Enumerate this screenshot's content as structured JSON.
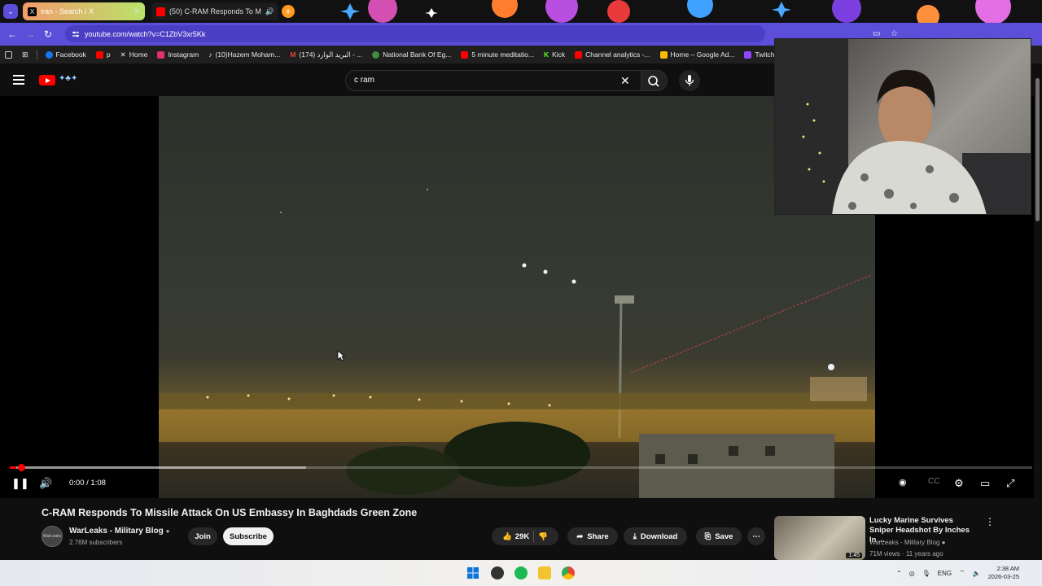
{
  "browser": {
    "tabs": [
      {
        "label": "iran - Search / X",
        "active": false
      },
      {
        "label": "(50) C-RAM Responds To M",
        "active": true
      }
    ],
    "new_tab": "+",
    "url": "youtube.com/watch?v=C1ZbV3xr5Kk",
    "bookmarks": [
      {
        "label": "Facebook",
        "icon": "facebook-icon",
        "color": "#1877f2"
      },
      {
        "label": "p",
        "icon": "youtube-icon",
        "color": "#ff0000"
      },
      {
        "label": "Home",
        "icon": "x-icon",
        "color": "#ffffff"
      },
      {
        "label": "Instagram",
        "icon": "instagram-icon",
        "color": "#e1306c"
      },
      {
        "label": "(10)Hazem Moham...",
        "icon": "tiktok-icon",
        "color": "#ffffff"
      },
      {
        "label": "(174) البريد الوارد - ...",
        "icon": "gmail-icon",
        "color": "#ea4335"
      },
      {
        "label": "National Bank Of Eg...",
        "icon": "bank-icon",
        "color": "#3d8f3d"
      },
      {
        "label": "5 minute meditatio...",
        "icon": "youtube-icon",
        "color": "#ff0000"
      },
      {
        "label": "Kick",
        "icon": "kick-icon",
        "color": "#53fc18"
      },
      {
        "label": "Channel analytics -...",
        "icon": "youtube-icon",
        "color": "#ff0000"
      },
      {
        "label": "Home – Google Ad...",
        "icon": "google-ads-icon",
        "color": "#fbbc04"
      },
      {
        "label": "Twitch",
        "icon": "twitch-icon",
        "color": "#9146ff"
      }
    ]
  },
  "youtube": {
    "search_query": "c ram",
    "player": {
      "current_time": "0:00 / 1:08",
      "progress_played": 0.006,
      "progress_buffered": 0.29
    },
    "video": {
      "title": "C-RAM Responds To Missile Attack On US Embassy In Baghdads Green Zone",
      "channel": "WarLeaks - Military Blog",
      "subscribers": "2.76M subscribers",
      "avatar_text": "WarLeaks",
      "join_label": "Join",
      "subscribe_label": "Subscribe",
      "likes": "29K",
      "share_label": "Share",
      "download_label": "Download",
      "save_label": "Save"
    },
    "recommendation": {
      "title": "Lucky Marine Survives Sniper Headshot By Inches In ...",
      "channel": "WarLeaks - Military Blog",
      "meta": "71M views · 11 years ago",
      "duration": "1:45"
    }
  },
  "taskbar": {
    "language": "ENG",
    "time": "2:38 AM",
    "date": "2026-03-25"
  },
  "colors": {
    "accent_red": "#ff0000",
    "address_bar": "#5b4fd9",
    "page_bg": "#0f0f0f"
  }
}
